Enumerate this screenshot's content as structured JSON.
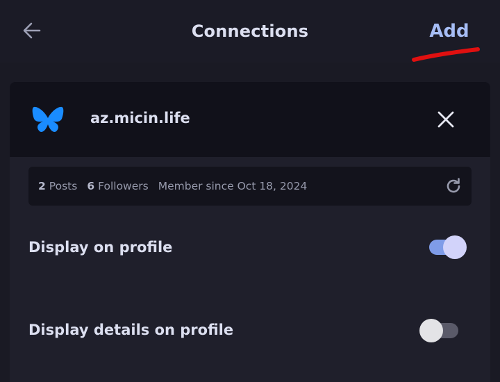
{
  "header": {
    "title": "Connections",
    "add_label": "Add",
    "back_icon": "arrow-left-icon"
  },
  "annotation": {
    "color": "#e01010",
    "kind": "red-underline-mark"
  },
  "connection": {
    "service_icon": "butterfly-icon",
    "service_color": "#1a8cff",
    "account": "az.micin.life",
    "remove_icon": "close-icon",
    "stats": {
      "posts_count": "2",
      "posts_label": "Posts",
      "followers_count": "6",
      "followers_label": "Followers",
      "member_since": "Member since Oct 18, 2024"
    },
    "refresh_icon": "refresh-icon"
  },
  "settings": [
    {
      "label": "Display on profile",
      "enabled": true
    },
    {
      "label": "Display details on profile",
      "enabled": false
    }
  ],
  "colors": {
    "accent": "#a6bdf5",
    "toggle_on": "#7f9ce8",
    "toggle_off": "#5a5a69",
    "background": "#1a1a24",
    "card": "#1f1f2b",
    "card_header": "#11111a"
  }
}
